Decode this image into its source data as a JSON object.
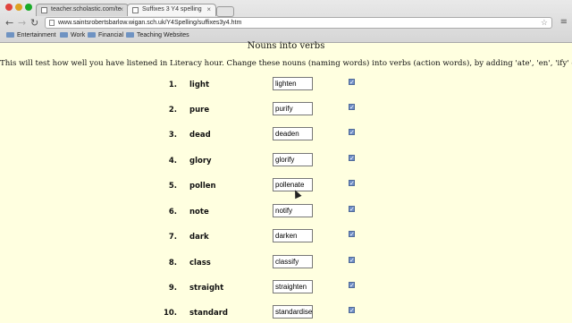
{
  "browser": {
    "tabs": [
      {
        "title": "teacher.scholastic.com/te",
        "active": false
      },
      {
        "title": "Suffixes 3 Y4 spelling",
        "active": true
      }
    ],
    "address": "www.saintsrobertsbarlow.wigan.sch.uk/Y4Spelling/suffixes3y4.htm",
    "bookmarks": [
      "Entertainment",
      "Work",
      "Financial",
      "Teaching Websites"
    ]
  },
  "page": {
    "heading": "Nouns into verbs",
    "intro": "This will test how well you have listened in Literacy hour. Change these nouns (naming words) into verbs (action words), by adding 'ate', 'en', 'ify' or 'ise'.",
    "items": [
      {
        "num": "1.",
        "noun": "light",
        "answer": "lighten"
      },
      {
        "num": "2.",
        "noun": "pure",
        "answer": "purify"
      },
      {
        "num": "3.",
        "noun": "dead",
        "answer": "deaden"
      },
      {
        "num": "4.",
        "noun": "glory",
        "answer": "glorify"
      },
      {
        "num": "5.",
        "noun": "pollen",
        "answer": "pollenate"
      },
      {
        "num": "6.",
        "noun": "note",
        "answer": "notify"
      },
      {
        "num": "7.",
        "noun": "dark",
        "answer": "darken"
      },
      {
        "num": "8.",
        "noun": "class",
        "answer": "classify"
      },
      {
        "num": "9.",
        "noun": "straight",
        "answer": "straighten"
      },
      {
        "num": "10.",
        "noun": "standard",
        "answer": "standardise"
      }
    ]
  },
  "colors": {
    "page_background": "#ffffe0",
    "checkbox": "#6f8ec7"
  }
}
